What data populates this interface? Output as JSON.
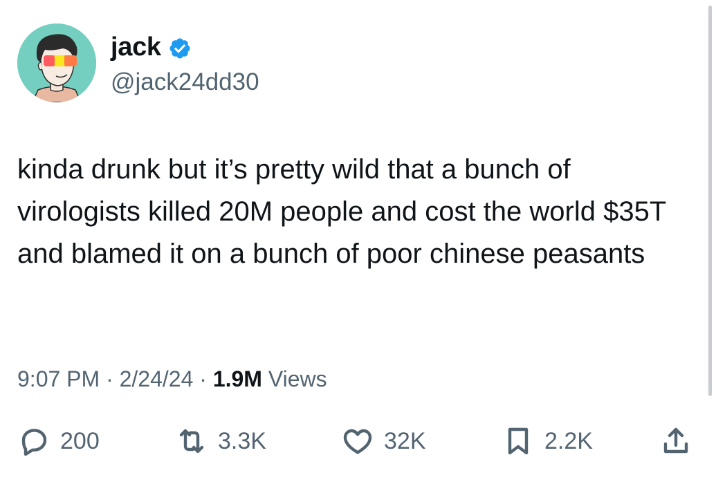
{
  "user": {
    "display_name": "jack",
    "handle": "@jack24dd30",
    "verified": true,
    "verified_color": "#1d9bf0"
  },
  "tweet": {
    "text": "kinda drunk but it’s pretty wild that a bunch of virologists killed 20M people and cost the world $35T and blamed it on a bunch of poor chinese peasants",
    "time": "9:07 PM",
    "date": "2/24/24",
    "separator": "·",
    "views_count": "1.9M",
    "views_label": "Views"
  },
  "actions": {
    "reply": {
      "icon": "reply-icon",
      "count": "200"
    },
    "retweet": {
      "icon": "retweet-icon",
      "count": "3.3K"
    },
    "like": {
      "icon": "heart-icon",
      "count": "32K"
    },
    "bookmark": {
      "icon": "bookmark-icon",
      "count": "2.2K"
    },
    "share": {
      "icon": "share-icon"
    }
  },
  "colors": {
    "text": "#0f1419",
    "secondary": "#536471",
    "avatar_bg": "#74cfc0"
  }
}
